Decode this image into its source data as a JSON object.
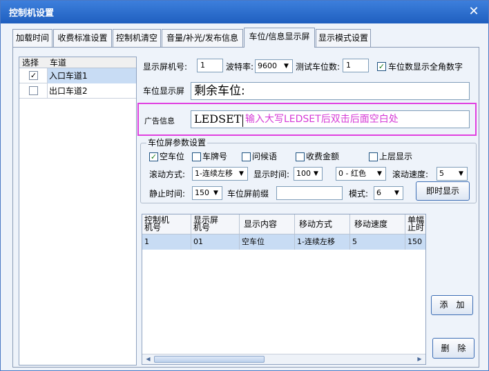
{
  "window": {
    "title": "控制机设置",
    "close_glyph": "✕"
  },
  "tabs": [
    {
      "label": "加载时间"
    },
    {
      "label": "收费标准设置"
    },
    {
      "label": "控制机清空"
    },
    {
      "label": "音量/补光/发布信息"
    },
    {
      "label": "车位/信息显示屏"
    },
    {
      "label": "显示模式设置"
    }
  ],
  "active_tab": "车位/信息显示屏",
  "lanes": {
    "col_select": "选择",
    "col_lane": "车道",
    "rows": [
      {
        "checked": true,
        "check_glyph": "✓",
        "name": "入口车道1"
      },
      {
        "checked": false,
        "check_glyph": "",
        "name": "出口车道2"
      }
    ]
  },
  "display": {
    "screen_no_label": "显示屏机号:",
    "screen_no": "1",
    "baud_label": "波特率:",
    "baud": "9600",
    "test_spaces_label": "测试车位数:",
    "test_spaces": "1",
    "fullwidth_label": "车位数显示全角数字",
    "fullwidth_glyph": "✓",
    "space_screen_label": "车位显示屏",
    "space_screen_text": "剩余车位:",
    "ad_label": "广告信息",
    "ad_text": "LEDSET",
    "ad_hint": "输入大写LEDSET后双击后面空白处"
  },
  "params": {
    "legend": "车位屏参数设置",
    "opt_empty": "空车位",
    "opt_empty_glyph": "✓",
    "opt_plate": "车牌号",
    "opt_greeting": "问候语",
    "opt_fee": "收费金额",
    "opt_upper": "上层显示",
    "scroll_mode_label": "滚动方式:",
    "scroll_mode": "1-连续左移",
    "show_time_label": "显示时间:",
    "show_time": "100",
    "color": "0 - 红色",
    "scroll_speed_label": "滚动速度:",
    "scroll_speed": "5",
    "still_time_label": "静止时间:",
    "still_time": "150",
    "prefix_label": "车位屏前缀",
    "prefix_value": "",
    "mode_label": "模式:",
    "mode": "6",
    "show_now_button": "即时显示"
  },
  "grid": {
    "headers": [
      [
        "控制机",
        "机号"
      ],
      [
        "显示屏",
        "机号"
      ],
      [
        "显示内容"
      ],
      [
        "移动方式"
      ],
      [
        "移动速度"
      ],
      [
        "单幅",
        "止时"
      ]
    ],
    "rows": [
      [
        "1",
        "01",
        "空车位",
        "1-连续左移",
        "5",
        "150"
      ]
    ]
  },
  "buttons": {
    "add": "添　加",
    "delete": "删　除"
  },
  "icons": {
    "dropdown": "▼",
    "scroll_left": "◀",
    "scroll_right": "▶"
  }
}
